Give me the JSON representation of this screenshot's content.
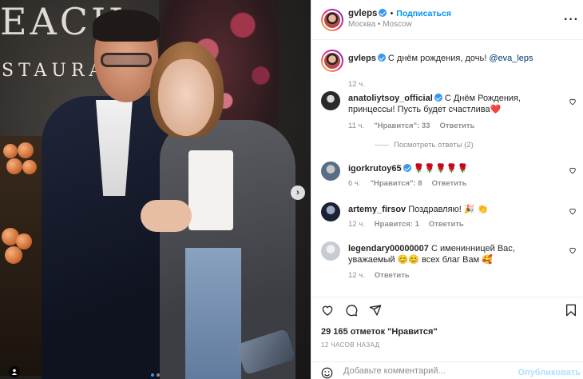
{
  "colors": {
    "accent": "#0095f6",
    "verified": "#3897f0",
    "muted": "#8e8e8e",
    "publish_disabled": "#b2dffc"
  },
  "photo": {
    "sign_top": "EACH",
    "sign_bottom": "STAURA",
    "nav_arrow": "›",
    "dots": 2,
    "active_dot": 0
  },
  "header": {
    "username": "gvleps",
    "follow_label": "Подписаться",
    "location": "Москва • Moscow",
    "more_icon": "more-horizontal-icon"
  },
  "caption": {
    "username": "gvleps",
    "text": "С днём рождения, дочь!",
    "mention": "@eva_leps",
    "time": "12 ч."
  },
  "comments": [
    {
      "username": "anatoliytsoy_official",
      "verified": true,
      "text": "С Днём Рождения, принцессы! Пусть будет счастлива❤️",
      "time": "11 ч.",
      "likes": "\"Нравится\": 33",
      "reply": "Ответить"
    },
    {
      "username": "igorkrutoy65",
      "verified": true,
      "text": "🌹🌹🌹🌹🌹",
      "time": "6 ч.",
      "likes": "\"Нравится\": 8",
      "reply": "Ответить"
    },
    {
      "username": "artemy_firsov",
      "verified": false,
      "text": "Поздравляю! 🎉 👏",
      "time": "12 ч.",
      "likes": "Нравится: 1",
      "reply": "Ответить"
    },
    {
      "username": "legendary00000007",
      "verified": false,
      "text": "С именинницей Вас, уважаемый 😊😊 всех благ Вам 🥰",
      "time": "12 ч.",
      "likes": "",
      "reply": "Ответить"
    }
  ],
  "view_replies": "Посмотреть ответы (2)",
  "likes_count": "29 165 отметок \"Нравится\"",
  "post_time": "12 ЧАСОВ НАЗАД",
  "add_comment": {
    "placeholder": "Добавьте комментарий...",
    "publish_label": "Опубликовать"
  }
}
